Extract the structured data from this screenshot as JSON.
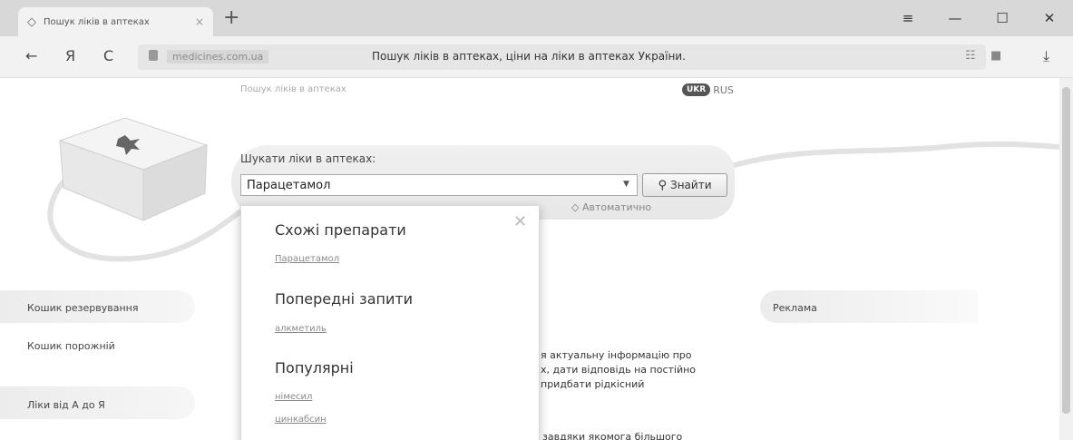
{
  "browser": {
    "tab_title": "Пошук ліків в аптеках",
    "tab_favicon": "◇",
    "tab_close": "×",
    "new_tab": "+",
    "menu_icon": "≡",
    "minimize": "—",
    "maximize": "☐",
    "close": "✕",
    "back": "←",
    "yandex": "Я",
    "reload": "C",
    "domain": "medicines.com.ua",
    "page_title": "Пошук ліків в аптеках, ціни на ліки в аптеках України.",
    "reader_icon": "☷",
    "bookmark_icon": "■",
    "download_icon": "⤓"
  },
  "header": {
    "tagline": "Пошук ліків в аптеках",
    "lang_ua": "UKR",
    "lang_ru": "RUS"
  },
  "search": {
    "label": "Шукати ліки в аптеках:",
    "value": "Парацетамол",
    "button": "Знайти",
    "auto_link": "Автоматично"
  },
  "sidebar": {
    "cart_title": "Кошик резервування",
    "cart_empty": "Кошик порожній",
    "az_title": "Ліки від А до Я"
  },
  "ads": {
    "title": "Реклама"
  },
  "body": {
    "line1": "я актуальну інформацію про",
    "line2": "х, дати відповідь на постійно",
    "line3": "придбати рідкісний",
    "line4": "завдяки якомога більшого"
  },
  "suggest": {
    "similar_heading": "Схожі препарати",
    "similar_items": [
      "Парацетамол"
    ],
    "previous_heading": "Попередні запити",
    "previous_items": [
      "алкметиль"
    ],
    "popular_heading": "Популярні",
    "popular_items": [
      "німесил",
      "цинкабсин"
    ]
  }
}
